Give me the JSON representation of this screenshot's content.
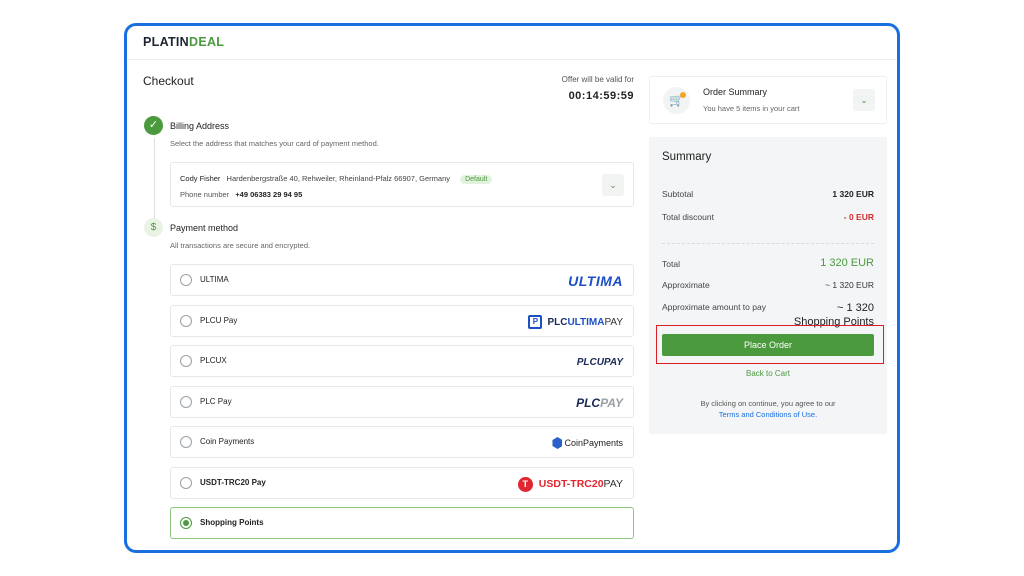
{
  "brand": {
    "part1": "PLATIN",
    "part2": "DEAL"
  },
  "checkout": {
    "title": "Checkout",
    "offer_label": "Offer will be valid for",
    "offer_time": "00:14:59:59"
  },
  "billing": {
    "title": "Billing Address",
    "subtitle": "Select the address that matches your card of payment method.",
    "name": "Cody Fisher",
    "address": "Hardenbergstraße 40, Rehweiler, Rheinland-Pfalz 66907, Germany",
    "badge": "Default",
    "phone_label": "Phone number",
    "phone": "+49 06383 29 94 95"
  },
  "payment": {
    "title": "Payment method",
    "subtitle": "All transactions are secure and encrypted.",
    "options": [
      {
        "label": "ULTIMA",
        "logo": "ULTIMA",
        "selected": false
      },
      {
        "label": "PLCU Pay",
        "logo_a": "PLC",
        "logo_b": "ULTIMA",
        "logo_c": "PAY",
        "selected": false
      },
      {
        "label": "PLCUX",
        "logo": "PLCUPAY",
        "selected": false
      },
      {
        "label": "PLC Pay",
        "logo_a": "PLC",
        "logo_b": "PAY",
        "selected": false
      },
      {
        "label": "Coin Payments",
        "logo": "CoinPayments",
        "selected": false
      },
      {
        "label": "USDT-TRC20 Pay",
        "logo_a": "USDT-TRC20",
        "logo_b": "PAY",
        "selected": false
      },
      {
        "label": "Shopping Points",
        "selected": true
      }
    ]
  },
  "order_summary": {
    "title": "Order Summary",
    "subtitle": "You have 5 items in your cart",
    "cart_icon": "cart-icon"
  },
  "summary": {
    "title": "Summary",
    "subtotal_label": "Subtotal",
    "subtotal_value": "1 320 EUR",
    "discount_label": "Total discount",
    "discount_value": "- 0 EUR",
    "total_label": "Total",
    "total_value": "1 320 EUR",
    "approx_label": "Approximate",
    "approx_value": "~ 1 320 EUR",
    "approx_pay_label": "Approximate amount to pay",
    "approx_pay_value": "~ 1 320",
    "approx_pay_unit": "Shopping Points",
    "place_order": "Place Order",
    "back_to_cart": "Back to Cart",
    "terms_text": "By clicking on continue, you agree to our",
    "terms_link": "Terms and Conditions of Use."
  },
  "colors": {
    "accent": "#4b9a3d",
    "frame": "#1a6fe0",
    "highlight": "#d81f26",
    "discount": "#d22e2e"
  }
}
